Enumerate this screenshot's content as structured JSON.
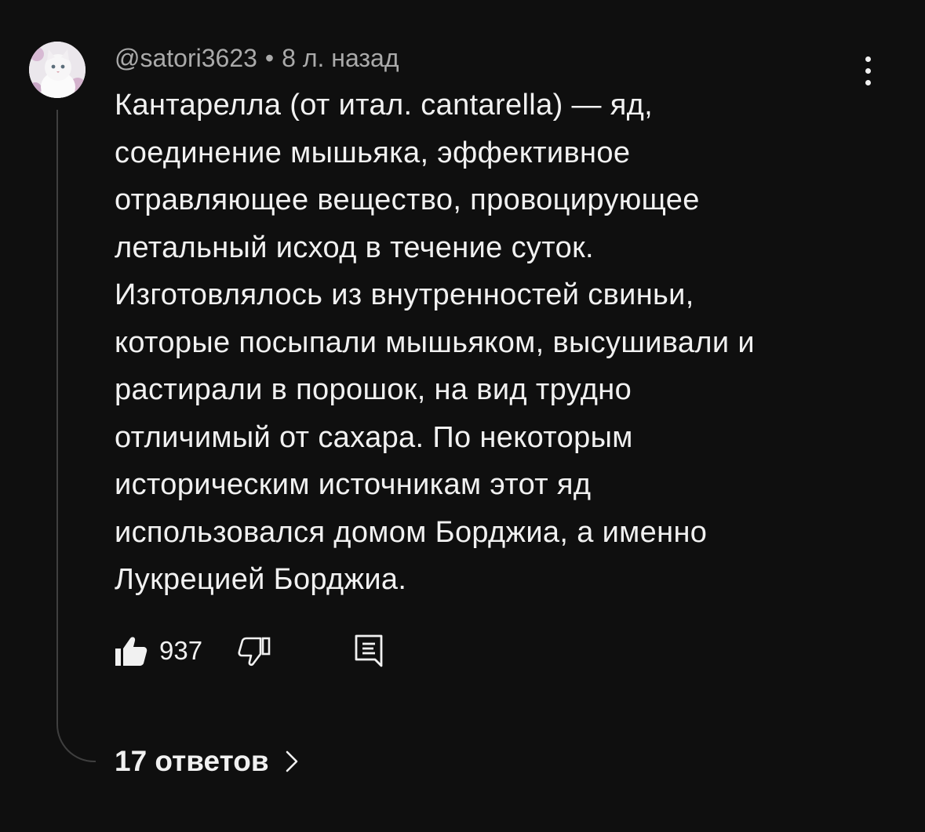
{
  "comment": {
    "author": "@satori3623",
    "separator": "•",
    "time_ago": "8 л. назад",
    "text_lines": [
      "Кантарелла (от итал. cantarella) — яд,",
      "соединение мышьяка, эффективное",
      "отравляющее вещество, провоцирующее",
      "летальный исход в течение суток.",
      "Изготовлялось из внутренностей свиньи,",
      "которые посыпали мышьяком, высушивали и",
      "растирали в порошок, на вид трудно",
      "отличимый от сахара. По некоторым",
      "историческим источникам этот яд",
      "использовался домом Борджиа, а именно",
      "Лукрецией Борджиа."
    ],
    "like_count": "937",
    "replies_label": "17 ответов"
  },
  "icons": {
    "avatar": "avatar-cat-image",
    "more": "more-vertical-icon",
    "like": "thumbs-up-icon",
    "dislike": "thumbs-down-icon",
    "reply": "comment-icon",
    "replies_chevron": "chevron-right-icon"
  },
  "colors": {
    "background": "#0f0f0f",
    "text_primary": "#f1f1f1",
    "text_secondary": "#aaaaaa",
    "thread_line": "#3f3f3f"
  }
}
